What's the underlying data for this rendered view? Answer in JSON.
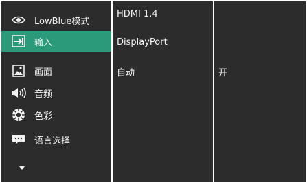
{
  "menu": {
    "items": [
      {
        "label": "LowBlue模式",
        "icon": "eye-icon"
      },
      {
        "label": "输入",
        "icon": "input-arrow-icon"
      },
      {
        "label": "画面",
        "icon": "picture-icon"
      },
      {
        "label": "音频",
        "icon": "speaker-icon"
      },
      {
        "label": "色彩",
        "icon": "color-wheel-icon"
      },
      {
        "label": "语言选择",
        "icon": "speech-bubble-icon"
      }
    ],
    "more_icon": "chevron-down-icon"
  },
  "submenu": {
    "options": [
      "HDMI 1.4",
      "DisplayPort",
      "自动"
    ]
  },
  "value_panel": {
    "value": "开"
  },
  "colors": {
    "panel_bg": "#2c2c2c",
    "active": "#2a9a7a",
    "text": "#f2f2f2"
  }
}
